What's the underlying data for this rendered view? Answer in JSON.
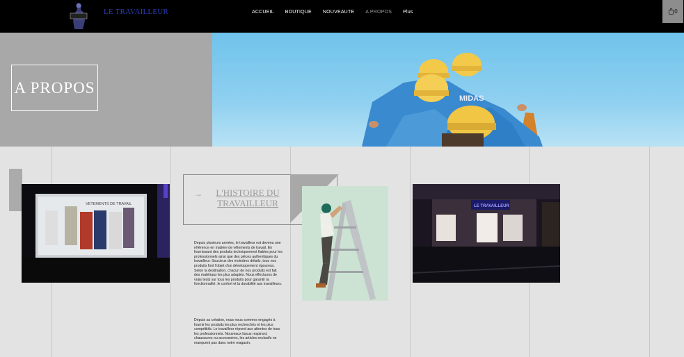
{
  "header": {
    "brand": "LE TRAVAILLEUR",
    "nav": [
      "ACCUEIL",
      "BOUTIQUE",
      "NOUVEAUTE",
      "A PROPOS",
      "Plus"
    ],
    "active_nav": "A PROPOS",
    "cart_count": "0",
    "cart_icon": "shopping-bag-icon"
  },
  "hero": {
    "title": "A PROPOS"
  },
  "histoire": {
    "title": "L'HISTOIRE DU TRAVAILLEUR",
    "arrow": "→"
  },
  "paragraphs": [
    "Depuis plusieurs années, le travailleur est devenu une référence en matière de vêtements de travail. En fournissant des produits techniquement fiables pour les professionnels ainsi que des pièces authentiques du travailleur. Soucieux des moindres détails, tous nos produits font l'objet d'un développement rigoureux. Selon la destination, chacun de nos produits est fait des matériaux les plus adaptés. Nous effectuons de vrais tests sur tous les produits pour garantir la fonctionnalité, le confort et la durabilité aux travailleurs.",
    "Depuis sa création, nous nous sommes engagés à fournir les produits les plus recherchés et les plus compétitifs. Le travailleur répond aux attentes de tous les professionnels. Nouveaux tissus respirant, chaussures ou accessoires, les articles exclusifs ne manquent pas dans notre magasin."
  ],
  "images": {
    "shop_window_sign": "VETEMENTS DE TRAVAIL",
    "storefront_sign": "LE TRAVAILLEUR"
  },
  "colors": {
    "brand": "#2d3cb8",
    "header_bg": "#000000",
    "page_bg": "#e4e3e4",
    "hero_grey": "#a9a8a9"
  }
}
